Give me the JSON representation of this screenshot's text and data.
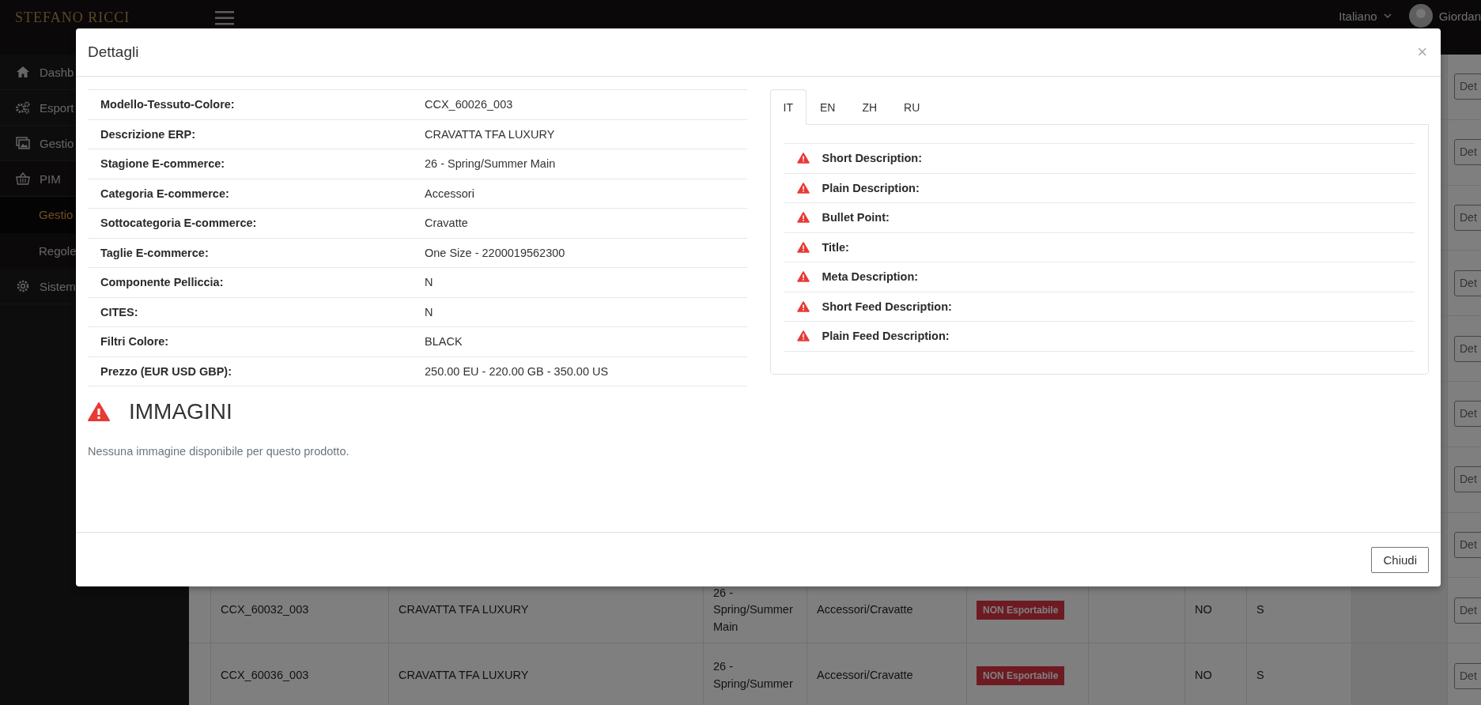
{
  "header": {
    "logo": "STEFANO RICCI",
    "language": "Italiano",
    "user": "Giordan"
  },
  "sidebar": {
    "items": [
      {
        "label": "Dashb",
        "selected": false
      },
      {
        "label": "Esport",
        "selected": false
      },
      {
        "label": "Gestio",
        "selected": false
      },
      {
        "label": "PIM",
        "selected": false,
        "children": [
          {
            "label": "Gestio",
            "selected": true
          },
          {
            "label": "Regole",
            "selected": false
          }
        ]
      },
      {
        "label": "Sistem",
        "selected": false
      }
    ]
  },
  "table": {
    "rows": [
      {
        "action": "Det"
      },
      {
        "action": "Det"
      },
      {
        "action": "Det"
      },
      {
        "action": "Det"
      },
      {
        "action": "Det"
      },
      {
        "action": "Det"
      },
      {
        "action": "Det"
      },
      {
        "action": "Det"
      },
      {
        "action": "Det",
        "cells": {
          "code": "CCX_60032_003",
          "description": "CRAVATTA TFA LUXURY",
          "season": "26 - Spring/Summer Main",
          "category": "Accessori/Cravatte",
          "status": "NON Esportabile",
          "column_8": "NO",
          "column_9": "S"
        }
      },
      {
        "action": "Det",
        "cells": {
          "code": "CCX_60036_003",
          "description": "CRAVATTA TFA LUXURY",
          "season": "26 - Spring/Summer",
          "category": "Accessori/Cravatte",
          "status": "NON Esportabile",
          "column_8": "NO",
          "column_9": "S"
        }
      }
    ]
  },
  "modal": {
    "title": "Dettagli",
    "close": "×",
    "details": [
      {
        "label": "Modello-Tessuto-Colore:",
        "value": "CCX_60026_003"
      },
      {
        "label": "Descrizione ERP:",
        "value": "CRAVATTA TFA LUXURY"
      },
      {
        "label": "Stagione E-commerce:",
        "value": "26 - Spring/Summer Main"
      },
      {
        "label": "Categoria E-commerce:",
        "value": "Accessori"
      },
      {
        "label": "Sottocategoria E-commerce:",
        "value": "Cravatte"
      },
      {
        "label": "Taglie E-commerce:",
        "value": "One Size - 2200019562300"
      },
      {
        "label": "Componente Pelliccia:",
        "value": "N"
      },
      {
        "label": "CITES:",
        "value": "N"
      },
      {
        "label": "Filtri Colore:",
        "value": "BLACK"
      },
      {
        "label": "Prezzo (EUR USD GBP):",
        "value": "250.00 EU - 220.00 GB - 350.00 US"
      }
    ],
    "images": {
      "title": "IMMAGINI",
      "warning": true,
      "message": "Nessuna immagine disponibile per questo prodotto."
    },
    "translations": {
      "tabs": [
        {
          "label": "IT",
          "selected": true
        },
        {
          "label": "EN",
          "selected": false
        },
        {
          "label": "ZH",
          "selected": false
        },
        {
          "label": "RU",
          "selected": false
        }
      ],
      "fields": [
        {
          "label": "Short Description:",
          "warning": true
        },
        {
          "label": "Plain Description:",
          "warning": true
        },
        {
          "label": "Bullet Point:",
          "warning": true
        },
        {
          "label": "Title:",
          "warning": true
        },
        {
          "label": "Meta Description:",
          "warning": true
        },
        {
          "label": "Short Feed Description:",
          "warning": true
        },
        {
          "label": "Plain Feed Description:",
          "warning": true
        }
      ]
    },
    "footer_button": "Chiudi"
  }
}
